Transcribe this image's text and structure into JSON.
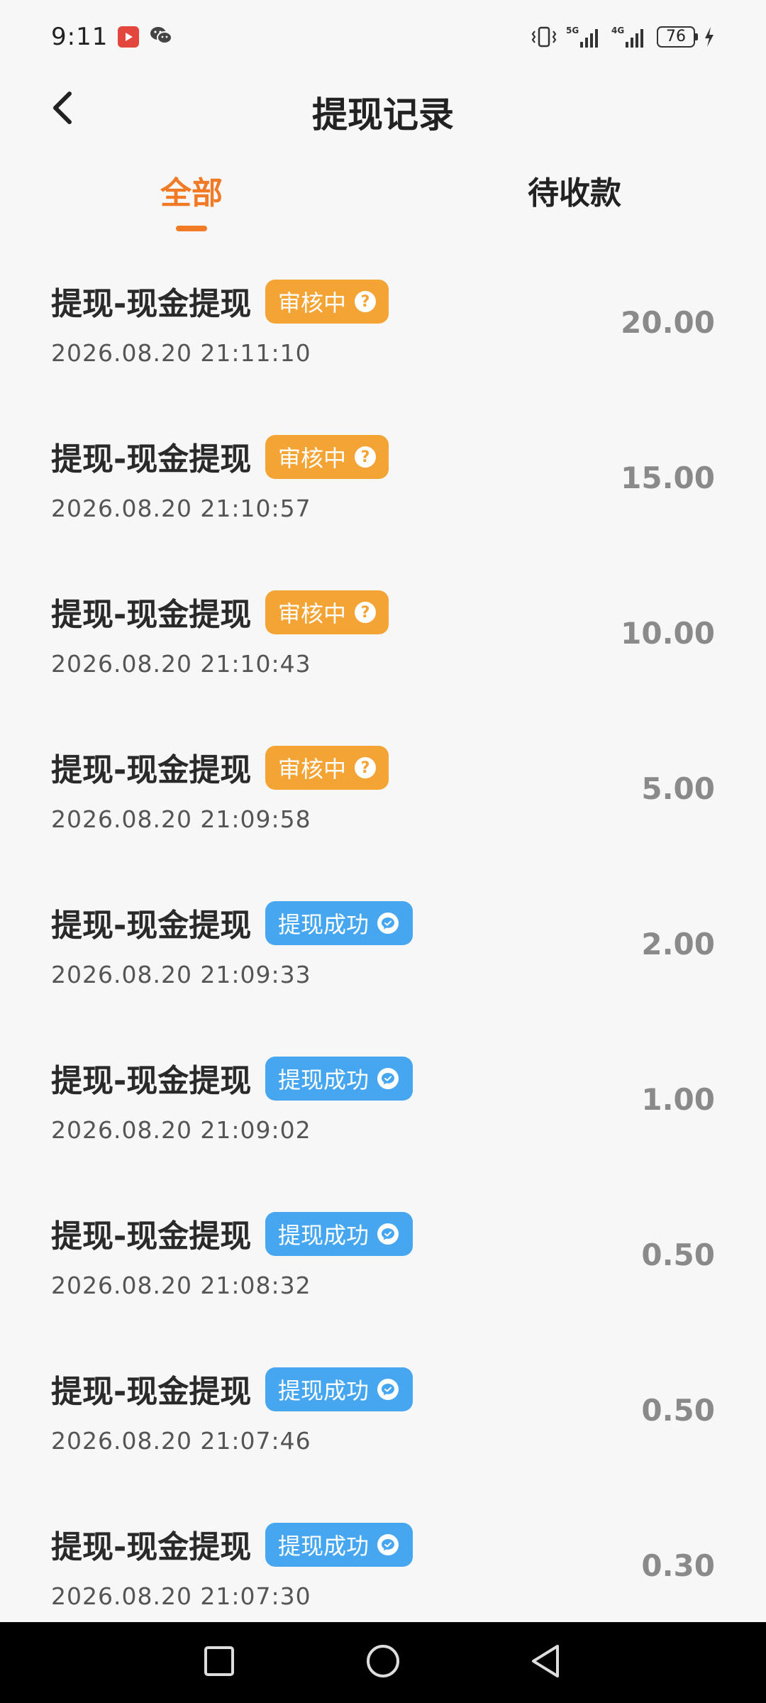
{
  "status_bar": {
    "time": "9:11",
    "network_1": "5G",
    "network_2": "4G",
    "battery": "76"
  },
  "header": {
    "title": "提现记录"
  },
  "tabs": [
    {
      "label": "全部",
      "active": true
    },
    {
      "label": "待收款",
      "active": false
    }
  ],
  "colors": {
    "accent": "#f07a26",
    "review_badge": "#f4a434",
    "success_badge": "#46a7f0"
  },
  "records": [
    {
      "title": "提现-现金提现",
      "status": "审核中",
      "status_type": "review",
      "time": "2026.08.20 21:11:10",
      "amount": "20.00"
    },
    {
      "title": "提现-现金提现",
      "status": "审核中",
      "status_type": "review",
      "time": "2026.08.20 21:10:57",
      "amount": "15.00"
    },
    {
      "title": "提现-现金提现",
      "status": "审核中",
      "status_type": "review",
      "time": "2026.08.20 21:10:43",
      "amount": "10.00"
    },
    {
      "title": "提现-现金提现",
      "status": "审核中",
      "status_type": "review",
      "time": "2026.08.20 21:09:58",
      "amount": "5.00"
    },
    {
      "title": "提现-现金提现",
      "status": "提现成功",
      "status_type": "success",
      "time": "2026.08.20 21:09:33",
      "amount": "2.00"
    },
    {
      "title": "提现-现金提现",
      "status": "提现成功",
      "status_type": "success",
      "time": "2026.08.20 21:09:02",
      "amount": "1.00"
    },
    {
      "title": "提现-现金提现",
      "status": "提现成功",
      "status_type": "success",
      "time": "2026.08.20 21:08:32",
      "amount": "0.50"
    },
    {
      "title": "提现-现金提现",
      "status": "提现成功",
      "status_type": "success",
      "time": "2026.08.20 21:07:46",
      "amount": "0.50"
    },
    {
      "title": "提现-现金提现",
      "status": "提现成功",
      "status_type": "success",
      "time": "2026.08.20 21:07:30",
      "amount": "0.30"
    }
  ]
}
